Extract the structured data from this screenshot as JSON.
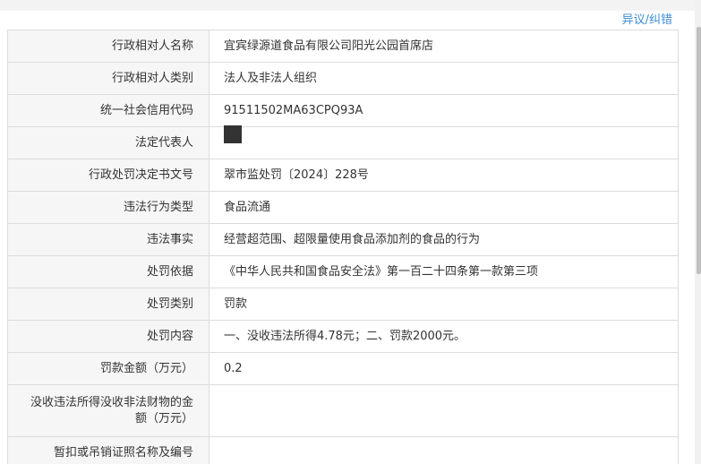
{
  "header": {
    "objection_link": "异议/纠错"
  },
  "rows": [
    {
      "label": "行政相对人名称",
      "value": "宜宾绿源道食品有限公司阳光公园首席店"
    },
    {
      "label": "行政相对人类别",
      "value": "法人及非法人组织"
    },
    {
      "label": "统一社会信用代码",
      "value": "91511502MA63CPQ93A"
    },
    {
      "label": "法定代表人",
      "value": ""
    },
    {
      "label": "行政处罚决定书文号",
      "value": "翠市监处罚〔2024〕228号"
    },
    {
      "label": "违法行为类型",
      "value": "食品流通"
    },
    {
      "label": "违法事实",
      "value": "经营超范围、超限量使用食品添加剂的食品的行为"
    },
    {
      "label": "处罚依据",
      "value": "《中华人民共和国食品安全法》第一百二十四条第一款第三项"
    },
    {
      "label": "处罚类别",
      "value": "罚款"
    },
    {
      "label": "处罚内容",
      "value": "一、没收违法所得4.78元；二、罚款2000元。"
    },
    {
      "label": "罚款金额（万元）",
      "value": "0.2"
    },
    {
      "label": "没收违法所得没收非法财物的金额（万元）",
      "value": ""
    },
    {
      "label": "暂扣或吊销证照名称及编号",
      "value": ""
    }
  ]
}
